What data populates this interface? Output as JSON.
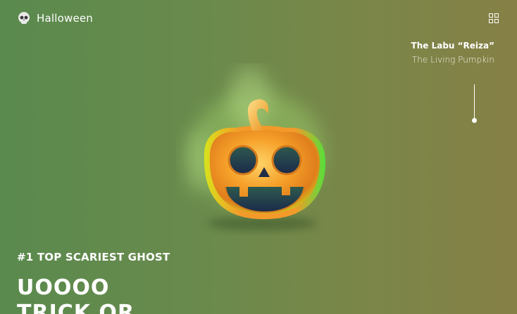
{
  "header": {
    "brand": "Halloween",
    "logo_icon": "skull-icon",
    "menu_icon": "grid-icon"
  },
  "caption": {
    "title": "The Labu “Reiza”",
    "subtitle": "The Living Pumpkin"
  },
  "hero": {
    "image_icon": "jack-o-lantern-icon",
    "rank": "#1 TOP SCARIEST GHOST",
    "headline_line1": "UOOOO",
    "headline_line2": "TRICK OR"
  },
  "colors": {
    "bg_left": "#5a8a4e",
    "bg_right": "#868046",
    "pumpkin": "#f6a12a",
    "glow": "#9fd16a"
  }
}
